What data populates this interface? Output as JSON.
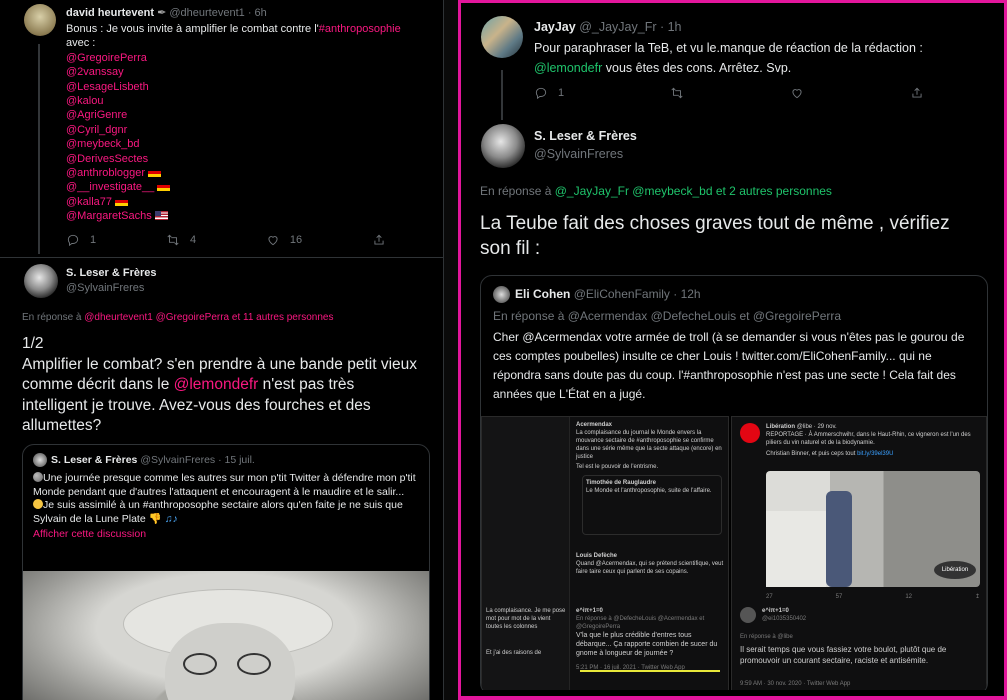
{
  "left": {
    "tweet1": {
      "name": "david heurtevent",
      "handle_time": "@dheurtevent1 · 6h",
      "text_prefix": "Bonus : Je vous invite à amplifier le combat contre l'",
      "hashtag": "#anthroposophie",
      "text_suffix": "avec :",
      "mentions": [
        "@GregoirePerra",
        "@2vanssay",
        "@LesageLisbeth",
        "@kalou",
        "@AgriGenre",
        "@Cyril_dgnr",
        "@meybeck_bd",
        "@DerivesSectes",
        "@anthroblogger",
        "@__investigate__",
        "@kalla77",
        "@MargaretSachs"
      ],
      "actions": {
        "reply": "1",
        "retweet": "4",
        "like": "16"
      }
    },
    "tweet2": {
      "name": "S. Leser & Frères",
      "handle": "@SylvainFreres",
      "reply_prefix": "En réponse à",
      "reply_to": "@dheurtevent1 @GregoirePerra",
      "reply_others": "et 11 autres personnes",
      "line0": "1/2",
      "text_a": "Amplifier le combat? s'en prendre à une bande petit vieux comme décrit dans le ",
      "mention": "@lemondefr",
      "text_b": " n'est pas très intelligent je trouve. Avez-vous des fourches et des allumettes?",
      "quote": {
        "name": "S. Leser & Frères",
        "handle_date": "@SylvainFreres · 15 juil.",
        "p1": "Une journée presque comme les autres sur mon p'tit Twitter à défendre mon p'tit Monde pendant que d'autres l'attaquent et encouragent à le maudire et le salir...",
        "p2": "Je suis assimilé à un #anthroposophe sectaire alors qu'en faite je ne suis que Sylvain de la Lune Plate",
        "link": "Afficher cette discussion"
      }
    }
  },
  "right": {
    "tweet1": {
      "name": "JayJay",
      "handle_time": "@_JayJay_Fr · 1h",
      "line1": "Pour paraphraser la TeB, et vu le.manque de réaction de la rédaction :",
      "mention": "@lemondefr",
      "line2": " vous êtes des cons. Arrêtez. Svp.",
      "actions": {
        "reply": "1"
      }
    },
    "tweet2": {
      "name": "S. Leser & Frères",
      "handle": "@SylvainFreres",
      "reply_prefix": "En réponse à",
      "reply_to": "@_JayJay_Fr @meybeck_bd",
      "reply_others": "et 2 autres personnes",
      "text": "La Teube fait des choses graves tout de même , vérifiez son fil :",
      "quote": {
        "name": "Eli Cohen",
        "handle_time": "@EliCohenFamily · 12h",
        "reply_line": "En réponse à @Acermendax @DefecheLouis  et  @GregoirePerra",
        "text": "Cher @Acermendax votre armée de troll (à se demander si vous n'êtes pas le gourou de ces comptes poubelles) insulte ce cher Louis ! twitter.com/EliCohenFamily... qui ne répondra sans doute pas du coup. l'#anthroposophie n'est pas une secte ! Cela fait des années que L'État en a jugé."
      }
    },
    "screens": {
      "a_name": "Acermendax",
      "a_text": "La complaisance du journal le Monde envers la mouvance sectaire de #anthroposophie se confirme dans une série même que la secte attaque (encore) en justice",
      "a_text2": "Tel est le pouvoir de l'entrisme.",
      "b_name": "Timothée de Rauglaudre",
      "b_text": "Le Monde et l'anthroposophie, suite de l'affaire.",
      "c_name": "Louis Defèche",
      "c_text": "Quand @Acermendax, qui se prétend scientifique, veut faire taire ceux qui parlent de ses copains.",
      "d_name": "e^iπ+1=0",
      "d_reply": "En réponse à @DefecheLouis @Acermendax et @GregoirePerra",
      "d_text": "V'la que le plus crédible d'entres tous débarque... Ça rapporte combien de sucer du gnome à longueur de journée ?",
      "d_time": "5:21 PM · 16 juil. 2021 · Twitter Web App",
      "lib_name": "Libération",
      "lib_handle": "@libe · 29 nov.",
      "lib_text": "REPORTAGE · À Ammerschwihr, dans le Haut-Rhin, ce vigneron est l'un des piliers du vin naturel et de la biodynamie.",
      "lib_text2": "Christian Binner, et puis ceps tout",
      "lib_link": "bit.ly/39el39U",
      "lib_stamp": "Libération",
      "lib_counts": {
        "reply": "27",
        "retweet": "57",
        "like": "12"
      },
      "e_name": "e^iπ+1=0",
      "e_handle": "@ei1035350402",
      "e_reply": "En réponse à @libe",
      "e_text": "Il serait temps que vous fassiez votre boulot, plutôt que de promouvoir un courant sectaire, raciste et antisémite.",
      "e_time": "9:59 AM · 30 nov. 2020 · Twitter Web App",
      "left_text": "La complaisance. Je me pose mot pour mot de la vient toutes les colonnes",
      "left_text2": "Et j'ai des raisons de"
    }
  }
}
